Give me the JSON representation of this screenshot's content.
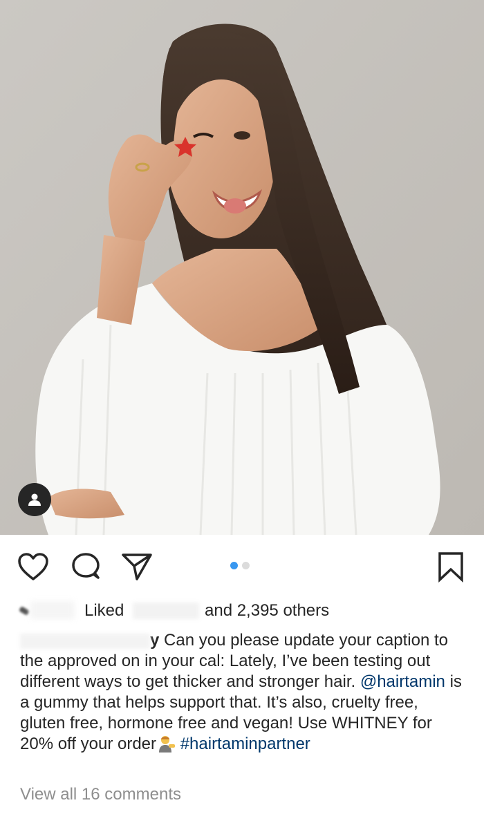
{
  "post": {
    "image_alt": "Smiling woman with long dark hair in a white off-shoulder sweater holding a red star-shaped gummy",
    "carousel": {
      "current": 1,
      "total": 2
    },
    "likes": {
      "liked_prefix": "Liked",
      "suffix": "and 2,395 others"
    },
    "caption": {
      "username_tail": "y",
      "text_1": " Can you please update your caption to the approved on in your cal: Lately, I’ve been testing out different ways to get thicker and stronger hair. ",
      "mention": "@hairtamin",
      "text_2": " is a gummy that helps support that. It’s also, cruelty free, gluten free, hormone free and vegan! Use WHITNEY for 20% off your order",
      "hashtag": "#hairtaminpartner"
    },
    "view_comments": "View all 16 comments"
  },
  "icons": {
    "like": "heart-icon",
    "comment": "comment-bubble-icon",
    "share": "paper-plane-icon",
    "save": "bookmark-icon",
    "tag": "user-tag-icon"
  },
  "colors": {
    "active_dot": "#3897f0",
    "inactive_dot": "#dbdbdb",
    "link": "#00376b",
    "muted": "#8e8e8e"
  }
}
